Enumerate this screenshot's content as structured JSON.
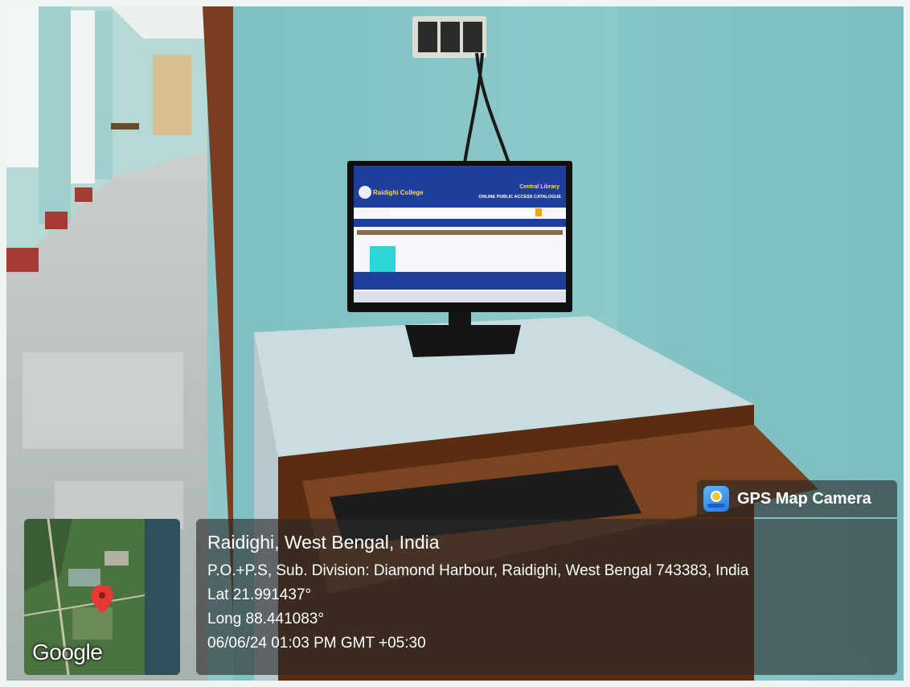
{
  "photo": {
    "monitor_screen": {
      "college_name": "Raidighi College",
      "library_title": "Central Library",
      "catalogue_title": "ONLINE PUBLIC ACCESS CATALOGUE"
    }
  },
  "map_thumbnail": {
    "icon": "map-pin-icon",
    "attribution": "Google"
  },
  "gps_badge": {
    "icon": "gps-map-camera-icon",
    "label": "GPS Map Camera"
  },
  "location": {
    "title": "Raidighi, West Bengal, India",
    "address": "P.O.+P.S, Sub. Division: Diamond Harbour, Raidighi, West Bengal 743383, India",
    "lat": "Lat 21.991437°",
    "long": "Long 88.441083°",
    "datetime": "06/06/24 01:03 PM GMT +05:30"
  },
  "colors": {
    "wall": "#8ec7c7",
    "desk_top": "#c9dde0",
    "desk_wood": "#5a2d12",
    "overlay": "#282828",
    "opac_header": "#1f3f9a"
  }
}
